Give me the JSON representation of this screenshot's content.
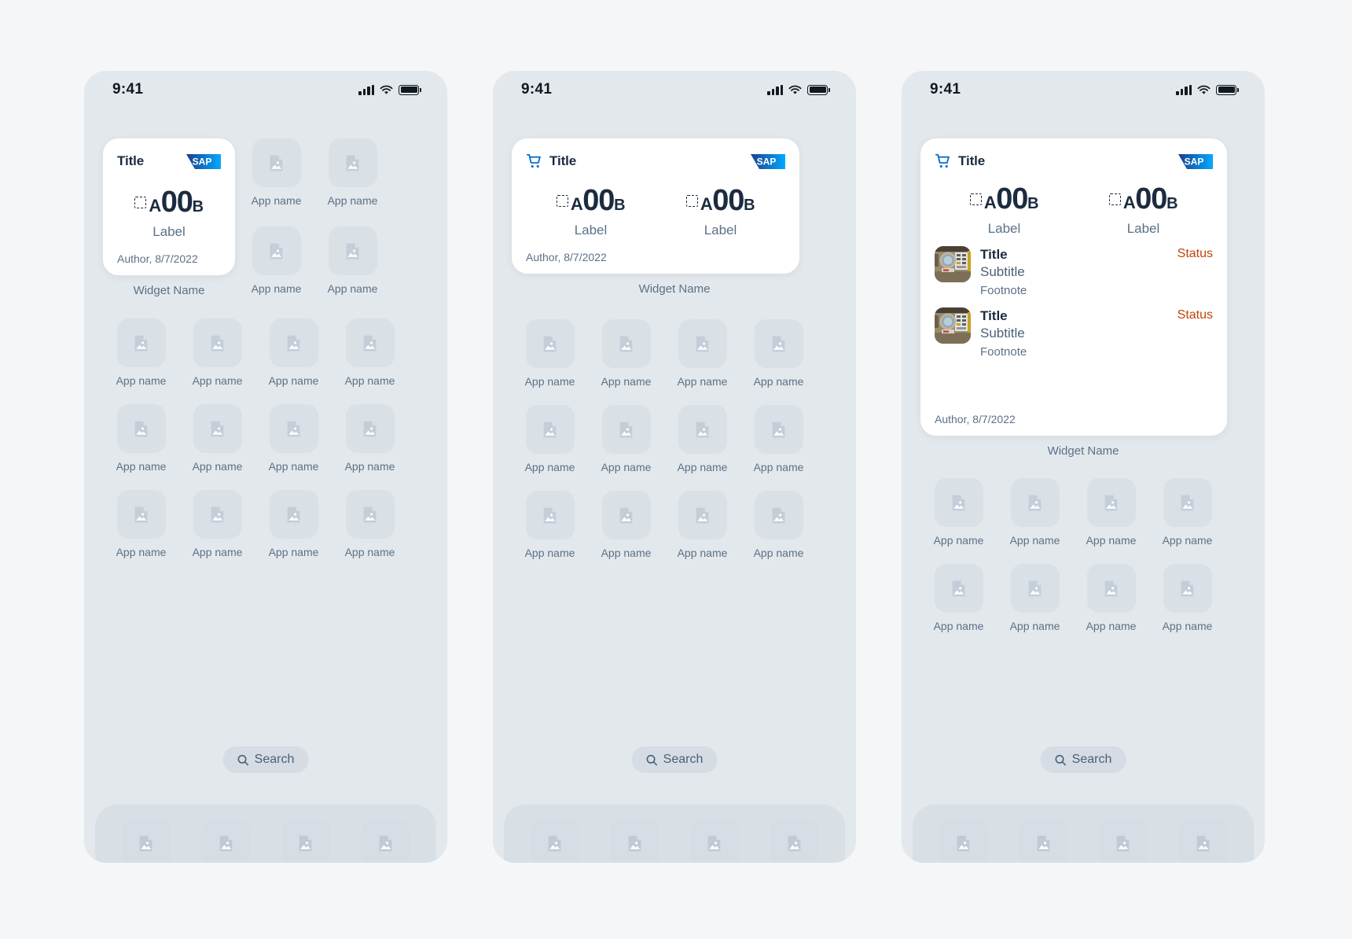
{
  "meta": {
    "canvas_bg": "#f4f6f8",
    "phone_bg": "#e3e8ec",
    "card_bg": "#ffffff",
    "accent_blue": "#0a6ed1",
    "text_dark": "#1c2b3e",
    "text_muted": "#5b7186",
    "status_orange": "#bf4508"
  },
  "status_bar": {
    "time": "9:41",
    "signal_icon": "cellular-signal-icon",
    "wifi_icon": "wifi-icon",
    "battery_icon": "battery-full-icon"
  },
  "labels": {
    "app_name": "App name",
    "widget_name": "Widget Name",
    "search": "Search",
    "search_icon": "search-icon",
    "app_icon": "image-placeholder-icon",
    "sap_logo": "sap-logo",
    "cart_icon": "shopping-cart-icon",
    "kpi_placeholder_icon": "dashed-square-placeholder-icon",
    "thumbnail_icon": "industrial-gauge-photo-thumbnail"
  },
  "widget_common": {
    "title": "Title",
    "author": "Author, 8/7/2022",
    "kpi": {
      "prefix": "A",
      "value": "00",
      "suffix": "B",
      "label": "Label"
    },
    "list_item": {
      "title": "Title",
      "subtitle": "Subtitle",
      "footnote": "Footnote",
      "status": "Status"
    }
  },
  "phones": [
    {
      "id": "phone-small-widget",
      "widget_size": "small",
      "has_cart_icon": false,
      "kpi_count": 1,
      "has_list": false,
      "top_right_grid_cols": 2,
      "top_right_grid_rows": 2,
      "mid_grid_cols": 4,
      "mid_grid_rows": 3
    },
    {
      "id": "phone-medium-widget",
      "widget_size": "medium",
      "has_cart_icon": true,
      "kpi_count": 2,
      "has_list": false,
      "top_right_grid_cols": 0,
      "top_right_grid_rows": 0,
      "mid_grid_cols": 4,
      "mid_grid_rows": 3
    },
    {
      "id": "phone-large-widget",
      "widget_size": "large",
      "has_cart_icon": true,
      "kpi_count": 2,
      "has_list": true,
      "list_rows": 2,
      "top_right_grid_cols": 0,
      "top_right_grid_rows": 0,
      "mid_grid_cols": 4,
      "mid_grid_rows": 2
    }
  ],
  "dock": {
    "item_count": 4,
    "icon": "image-placeholder-icon"
  }
}
